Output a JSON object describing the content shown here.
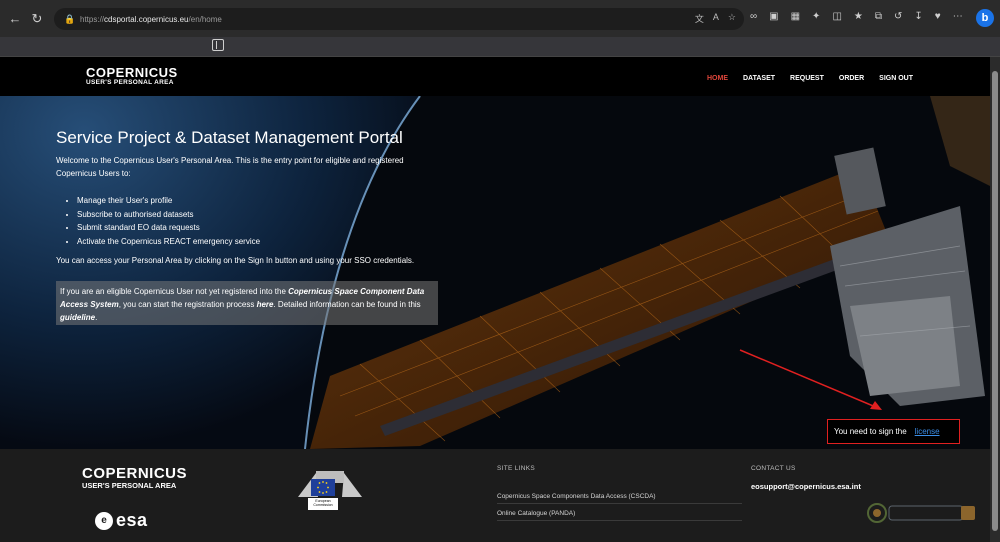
{
  "browser": {
    "url_prefix": "https://",
    "url_host": "cdsportal.copernicus.eu",
    "url_path": "/en/home"
  },
  "site": {
    "logo_line1": "COPERNICUS",
    "logo_line2": "USER'S PERSONAL AREA",
    "menu": [
      {
        "label": "HOME",
        "active": true
      },
      {
        "label": "DATASET"
      },
      {
        "label": "REQUEST"
      },
      {
        "label": "ORDER"
      },
      {
        "label": "SIGN OUT"
      }
    ]
  },
  "hero": {
    "title": "Service Project & Dataset Management Portal",
    "intro": "Welcome to the Copernicus User's Personal Area. This is the entry point for eligible and registered Copernicus Users to:",
    "list": [
      "Manage their User's profile",
      "Subscribe to authorised datasets",
      "Submit standard EO data requests",
      "Activate the Copernicus REACT emergency service"
    ],
    "access_text": "You can access your Personal Area by clicking on the Sign In button and using your SSO credentials.",
    "registration": {
      "part1": "If you are an eligible Copernicus User not yet registered into the ",
      "bold1": "Copernicus Space Component Data Access System",
      "part2": ", you can start the registration process ",
      "bold2": "here",
      "part3": ". Detailed information can be found in this ",
      "bold3": "guideline",
      "part4": "."
    }
  },
  "notice": {
    "text": "You need to sign the",
    "link": "license"
  },
  "footer": {
    "logo_line1": "COPERNICUS",
    "logo_line2": "USER'S PERSONAL AREA",
    "esa": "esa",
    "ec_label": "European Commission",
    "site_links_heading": "SITE LINKS",
    "site_links": [
      "Copernicus Space Components Data Access (CSCDA)",
      "Online Catalogue (PANDA)"
    ],
    "contact_heading": "CONTACT US",
    "contact_email": "eosupport@copernicus.esa.int"
  },
  "colors": {
    "accent_red": "#e0463b",
    "link_blue": "#3b8ee8",
    "notice_border": "#e02020"
  }
}
